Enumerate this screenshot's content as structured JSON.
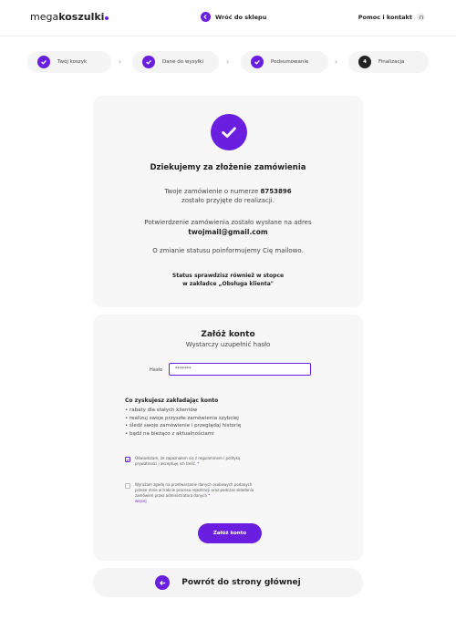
{
  "header": {
    "logo_light": "mega",
    "logo_bold": "koszulki",
    "back_to_shop": "Wróć do sklepu",
    "help": "Pomoc i kontakt"
  },
  "steps": [
    {
      "label": "Twój koszyk",
      "done": true
    },
    {
      "label": "Dane do wysyłki",
      "done": true
    },
    {
      "label": "Podsumowanie",
      "done": true
    },
    {
      "label": "Finalizacja",
      "number": "4",
      "done": false
    }
  ],
  "confirmation": {
    "title": "Dziekujemy za złożenie zamówienia",
    "order_line_prefix": "Twoje zamówienie o numerze",
    "order_number": "8753896",
    "order_line_2": "zostało przyjęte do realizacji.",
    "email_note": "Potwierdzenie zamówienia zostało wysłane na adres",
    "email": "twojmail@gmail.com",
    "status_info": "O zmianie statusu poinformujemy Cię mailowo.",
    "status_check_1": "Status sprawdzisz również w stopce",
    "status_check_2": "w zakładce „Obsługa klienta\""
  },
  "account": {
    "title": "Załóż konto",
    "subtitle": "Wystarczy uzupełnić hasło",
    "password_label": "Hasło",
    "password_value": "*******",
    "benefits_title": "Co zyskujesz zakładając konto",
    "benefits": [
      "• rabaty dla stałych klientów",
      "• realizuj swoje przyszłe zamówienia szybciej",
      "• śledź swoje zamówienie i przeglądaj historię",
      "• bądź na bieżąco z aktualnościami"
    ],
    "consent_terms": "Oświadczam, że zapoznałem się z regulaminem i polityką prywatności i akceptuję ich treść.",
    "consent_terms_checked": true,
    "consent_data": "Wyrażam zgodę na przetwarzanie danych osobowych podanych przeze mnie w trakcie procesu rejestracji oraz podczas składania zamówień przez administratora danych",
    "consent_data_checked": false,
    "consent_more": "więcej",
    "required_mark": "*",
    "create_button": "Załóż konto"
  },
  "footer": {
    "home_button": "Powrót do strony głównej"
  },
  "colors": {
    "accent": "#6a1ee0",
    "card_bg": "#f7f7f7"
  }
}
